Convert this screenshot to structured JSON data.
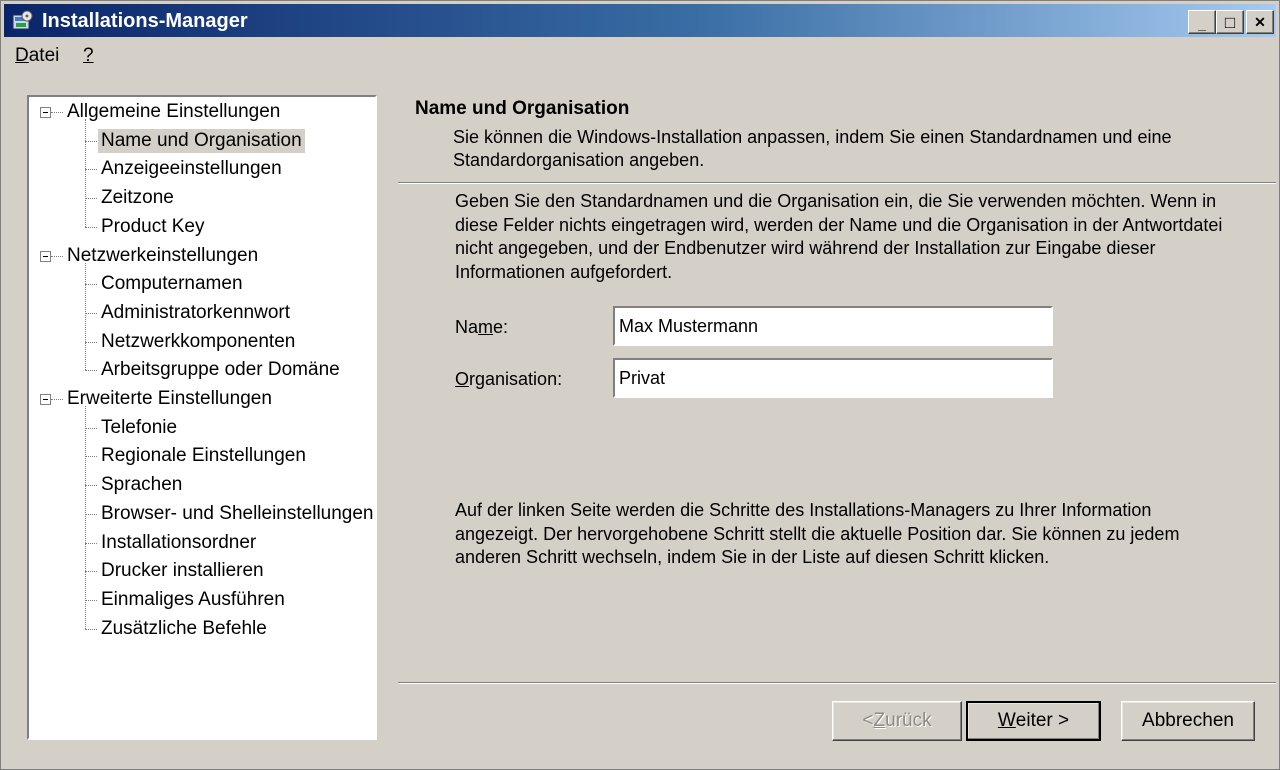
{
  "window": {
    "title": "Installations-Manager",
    "caption_buttons": {
      "minimize": "_",
      "maximize": "□",
      "close": "✕"
    }
  },
  "menu": [
    {
      "key": "D",
      "rest": "atei"
    },
    {
      "key": "?",
      "rest": ""
    }
  ],
  "tree": {
    "groups": [
      {
        "label": "Allgemeine Einstellungen",
        "items": [
          "Name und Organisation",
          "Anzeigeeinstellungen",
          "Zeitzone",
          "Product Key"
        ]
      },
      {
        "label": "Netzwerkeinstellungen",
        "items": [
          "Computernamen",
          "Administratorkennwort",
          "Netzwerkkomponenten",
          "Arbeitsgruppe oder Domäne"
        ]
      },
      {
        "label": "Erweiterte Einstellungen",
        "items": [
          "Telefonie",
          "Regionale Einstellungen",
          "Sprachen",
          "Browser- und Shelleinstellungen",
          "Installationsordner",
          "Drucker installieren",
          "Einmaliges Ausführen",
          "Zusätzliche Befehle"
        ]
      }
    ],
    "selected": "Name und Organisation"
  },
  "header": {
    "title": "Name und Organisation",
    "description": "Sie können die Windows-Installation anpassen, indem Sie einen Standardnamen und eine Standardorganisation angeben."
  },
  "instructions": "Geben Sie den Standardnamen und die Organisation ein, die Sie verwenden möchten. Wenn in diese Felder nichts eingetragen wird, werden der Name und die Organisation in der Antwortdatei nicht angegeben, und der Endbenutzer wird während der Installation zur Eingabe dieser Informationen aufgefordert.",
  "form": {
    "name_label_pre": "Na",
    "name_label_key": "m",
    "name_label_post": "e:",
    "name_value": "Max Mustermann",
    "org_label_key": "O",
    "org_label_post": "rganisation:",
    "org_value": "Privat"
  },
  "help_text": "Auf der linken Seite werden die Schritte des Installations-Managers zu Ihrer Information angezeigt. Der hervorgehobene Schritt stellt die aktuelle Position dar. Sie können zu jedem anderen Schritt wechseln, indem Sie in der Liste auf diesen Schritt klicken.",
  "buttons": {
    "back_pre": "< ",
    "back_key": "Z",
    "back_post": "urück",
    "next_key": "W",
    "next_post": "eiter >",
    "cancel": "Abbrechen"
  },
  "colors": {
    "title_gradient_start": "#0a246a",
    "title_gradient_end": "#a6caf0",
    "face": "#d4d0c8"
  }
}
